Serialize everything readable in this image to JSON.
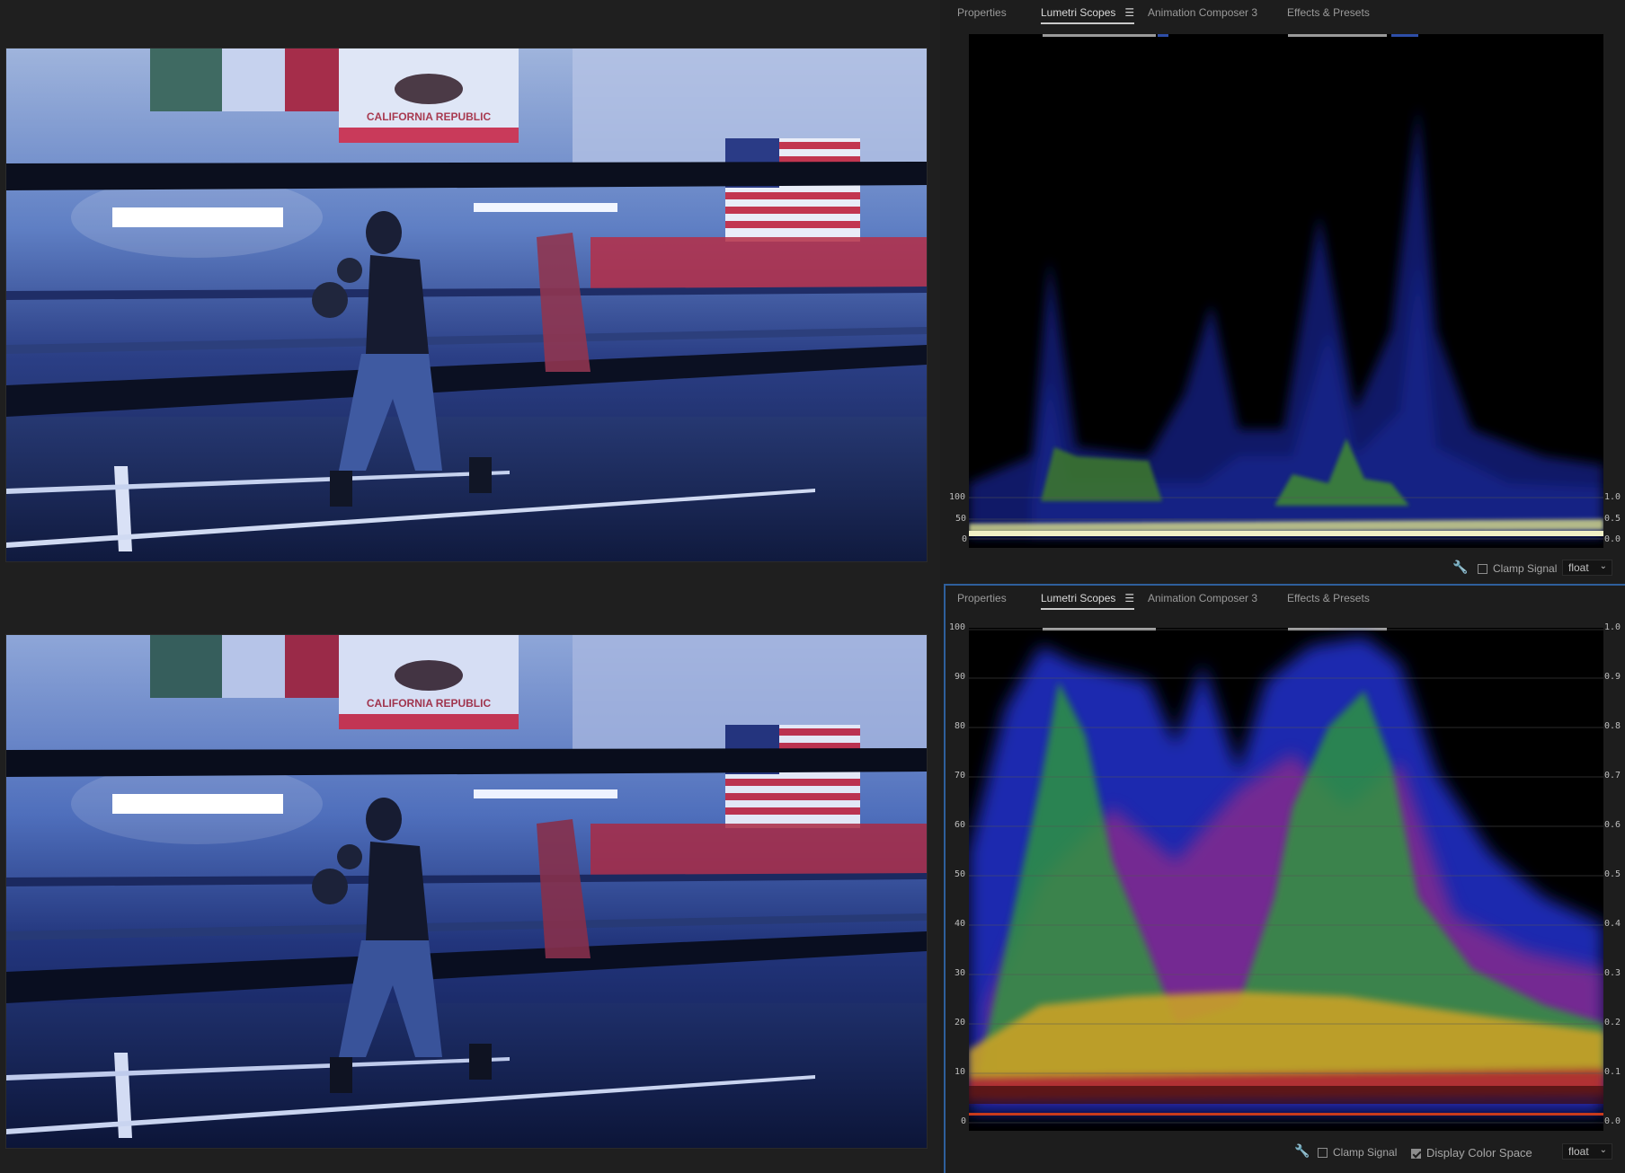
{
  "tabs": {
    "properties": "Properties",
    "lumetri_scopes": "Lumetri Scopes",
    "animation_composer": "Animation Composer 3",
    "effects_presets": "Effects & Presets",
    "menu_icon": "hamburger-menu-icon"
  },
  "top_scope": {
    "left_scale": [
      "100",
      "50",
      "0"
    ],
    "right_scale": [
      "1.0",
      "0.5",
      "0.0"
    ]
  },
  "bottom_scope": {
    "left_scale": [
      "100",
      "90",
      "80",
      "70",
      "60",
      "50",
      "40",
      "30",
      "20",
      "10",
      "0"
    ],
    "right_scale": [
      "1.0",
      "0.9",
      "0.8",
      "0.7",
      "0.6",
      "0.5",
      "0.4",
      "0.3",
      "0.2",
      "0.1",
      "0.0"
    ]
  },
  "footer_top": {
    "clamp_signal": "Clamp Signal",
    "format_value": "float"
  },
  "footer_bottom": {
    "clamp_signal": "Clamp Signal",
    "display_color_space": "Display Color Space",
    "format_value": "float"
  },
  "preview": {
    "flag_text": "CALIFORNIA REPUBLIC"
  },
  "colors": {
    "accent": "#2e5f9c",
    "panel_bg": "#1d1d1d",
    "scope_bg": "#000000"
  }
}
